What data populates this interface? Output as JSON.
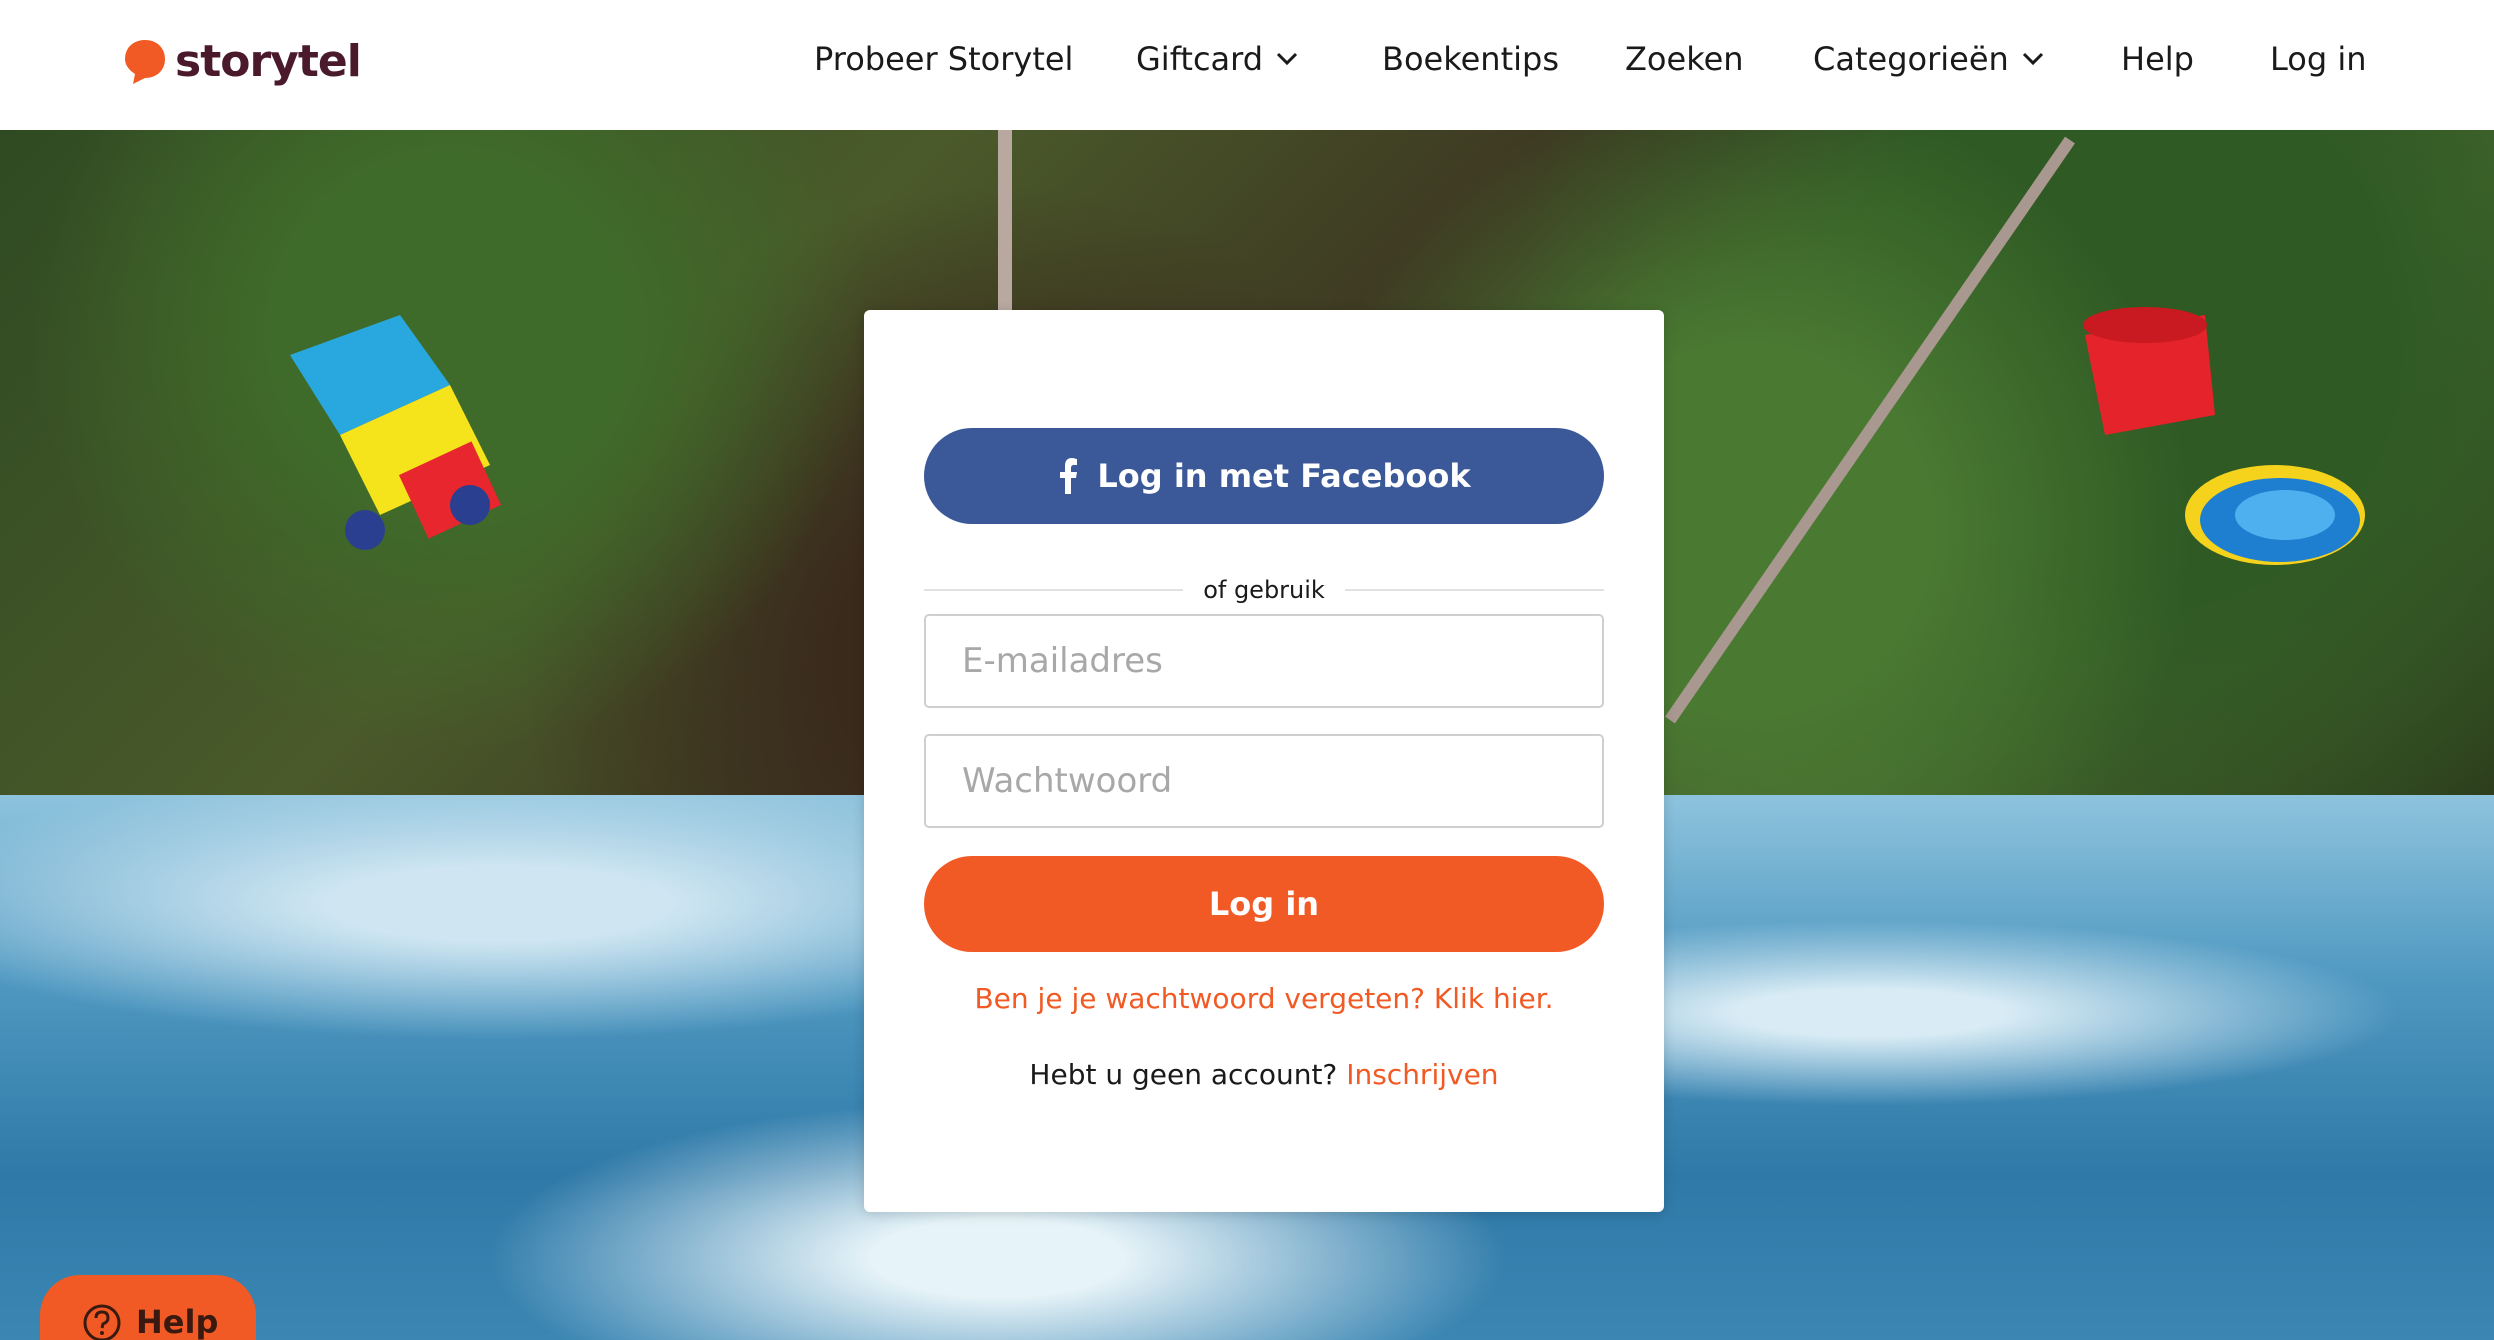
{
  "header": {
    "logo_text": "storytel",
    "nav": [
      {
        "label": "Probeer Storytel",
        "has_dropdown": false
      },
      {
        "label": "Giftcard",
        "has_dropdown": true
      },
      {
        "label": "Boekentips",
        "has_dropdown": false
      },
      {
        "label": "Zoeken",
        "has_dropdown": false
      },
      {
        "label": "Categorieën",
        "has_dropdown": true
      },
      {
        "label": "Help",
        "has_dropdown": false
      },
      {
        "label": "Log in",
        "has_dropdown": false
      }
    ]
  },
  "login": {
    "facebook_label": "Log in met Facebook",
    "divider_label": "of gebruik",
    "email_placeholder": "E-mailadres",
    "password_placeholder": "Wachtwoord",
    "login_label": "Log in",
    "forgot_label": "Ben je je wachtwoord vergeten? Klik hier.",
    "no_account_label": "Hebt u geen account?",
    "signup_label": "Inschrijven"
  },
  "help_widget": {
    "label": "Help"
  },
  "colors": {
    "brand_orange": "#f15a24",
    "facebook_blue": "#3b5998",
    "logo_text": "#4a1a2c"
  }
}
